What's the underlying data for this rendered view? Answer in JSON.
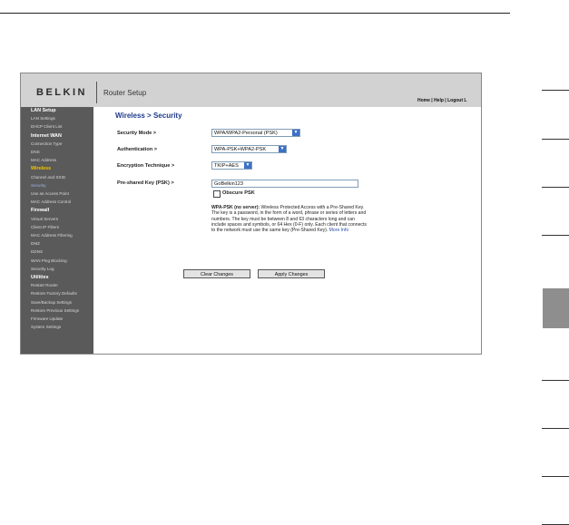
{
  "header": {
    "logo": "BELKIN",
    "title": "Router Setup",
    "links": "Home | Help | Logout   L"
  },
  "sidebar": {
    "items": [
      {
        "label": "LAN Setup",
        "type": "heading"
      },
      {
        "label": "LAN Settings",
        "type": "link"
      },
      {
        "label": "DHCP Client List",
        "type": "link"
      },
      {
        "label": "Internet WAN",
        "type": "heading"
      },
      {
        "label": "Connection Type",
        "type": "link"
      },
      {
        "label": "DNS",
        "type": "link"
      },
      {
        "label": "MAC Address",
        "type": "link"
      },
      {
        "label": "Wireless",
        "type": "active-heading"
      },
      {
        "label": "Channel and SSID",
        "type": "link"
      },
      {
        "label": "Security",
        "type": "current"
      },
      {
        "label": "Use as Access Point",
        "type": "link"
      },
      {
        "label": "MAC Address Control",
        "type": "link"
      },
      {
        "label": "Firewall",
        "type": "heading"
      },
      {
        "label": "Virtual Servers",
        "type": "link"
      },
      {
        "label": "Client IP Filters",
        "type": "link"
      },
      {
        "label": "MAC Address Filtering",
        "type": "link"
      },
      {
        "label": "DMZ",
        "type": "link"
      },
      {
        "label": "DDNS",
        "type": "link"
      },
      {
        "label": "WAN Ping Blocking",
        "type": "link"
      },
      {
        "label": "Security Log",
        "type": "link"
      },
      {
        "label": "Utilities",
        "type": "heading"
      },
      {
        "label": "Restart Router",
        "type": "link"
      },
      {
        "label": "Restore Factory Defaults",
        "type": "link"
      },
      {
        "label": "Save/Backup Settings",
        "type": "link"
      },
      {
        "label": "Restore Previous Settings",
        "type": "link"
      },
      {
        "label": "Firmware Update",
        "type": "link"
      },
      {
        "label": "System Settings",
        "type": "link"
      }
    ]
  },
  "page": {
    "title": "Wireless > Security",
    "security_mode_label": "Security Mode >",
    "security_mode_value": "WPA/WPA2-Personal (PSK)",
    "authentication_label": "Authentication >",
    "authentication_value": "WPA-PSK+WPA2-PSK",
    "encryption_label": "Encryption Technique >",
    "encryption_value": "TKIP+AES",
    "psk_label": "Pre-shared Key (PSK) >",
    "psk_value": "GoBelkin123",
    "obscure_label": "Obscure PSK",
    "obscure_checked": false,
    "desc_bold": "WPA-PSK (no server):",
    "desc_text": " Wireless Protected Access with a Pre-Shared Key. The key is a password, in the form of a word, phrase or series of letters and numbers. The key must be between 8 and 63 characters long and can include spaces and symbols, or 64 Hex (0-F) only. Each client that connects to the network must use the same key (Pre-Shared Key). ",
    "more_info": "More Info",
    "clear_button": "Clear Changes",
    "apply_button": "Apply Changes"
  }
}
